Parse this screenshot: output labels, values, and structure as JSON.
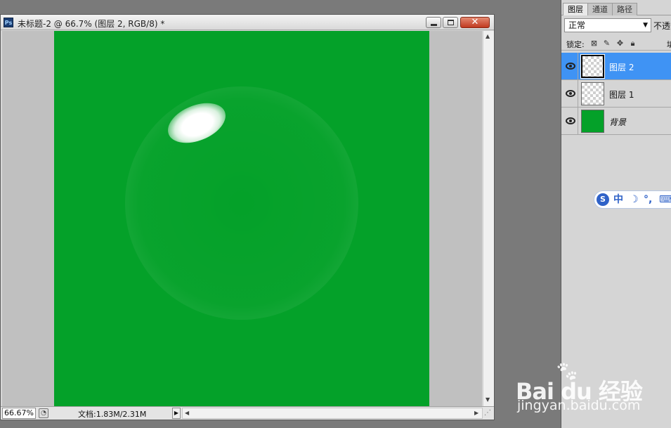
{
  "document": {
    "app_badge": "Ps",
    "title": "未标题-2 @ 66.7% (图层 2, RGB/8) *",
    "status": {
      "zoom": "66.67%",
      "doc_size": "文档:1.83M/2.31M"
    }
  },
  "canvas": {
    "background_color": "#04a129",
    "gutter_color": "#c0c0c0"
  },
  "layers_panel": {
    "tabs": [
      {
        "label": "图层",
        "active": true
      },
      {
        "label": "通道",
        "active": false
      },
      {
        "label": "路径",
        "active": false
      }
    ],
    "blend_mode": "正常",
    "opacity_label": "不透明",
    "lock_label": "锁定:",
    "fill_label_partial": "填",
    "layers": [
      {
        "name": "图层 2",
        "selected": true,
        "thumbnail": "transparent",
        "visible": true
      },
      {
        "name": "图层 1",
        "selected": false,
        "thumbnail": "transparent",
        "visible": true
      },
      {
        "name": "背景",
        "selected": false,
        "thumbnail": "solid-green",
        "visible": true,
        "italic": true
      }
    ]
  },
  "ime_toolbar": {
    "mode": "中",
    "items": [
      "中",
      "☽",
      "°,",
      "⌨"
    ]
  },
  "watermark": {
    "brand": "Bai du 经验",
    "url": "jingyan.baidu.com"
  }
}
